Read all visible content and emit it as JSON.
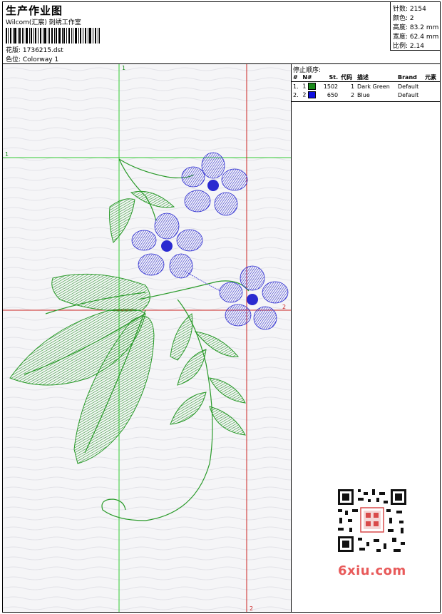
{
  "header": {
    "title": "生产作业图",
    "company": "Wilcom(汇宸) 刺绣工作室",
    "design_label": "花版: 1736215.dst",
    "colorway_label": "色位: Colorway 1"
  },
  "stats": [
    {
      "label": "针数:",
      "value": "2154"
    },
    {
      "label": "颜色:",
      "value": "2"
    },
    {
      "label": "高度:",
      "value": "83.2 mm"
    },
    {
      "label": "宽度:",
      "value": "62.4 mm"
    },
    {
      "label": "比例:",
      "value": "2.14"
    }
  ],
  "stop_sequence": {
    "title": "停止顺序:",
    "columns": [
      "#",
      "N#",
      "St.",
      "代码",
      "描述",
      "Brand",
      "元素"
    ],
    "rows": [
      {
        "num": "1.",
        "needle": "1",
        "stitches": "1502",
        "code": "1",
        "description": "Dark Green",
        "brand": "Default",
        "color": "#1a8a1a"
      },
      {
        "num": "2.",
        "needle": "2",
        "stitches": "650",
        "code": "2",
        "description": "Blue",
        "brand": "Default",
        "color": "#1010e0"
      }
    ]
  },
  "guides": {
    "green_label_top": "1",
    "green_label_left": "1",
    "red_label_right": "2",
    "red_label_bottom": "2"
  },
  "colors": {
    "thread_green": "#2a9a2a",
    "thread_blue": "#2a2ad0",
    "guide_green": "#33cc33",
    "guide_red": "#cc2222"
  },
  "watermark": "6xiu.com"
}
